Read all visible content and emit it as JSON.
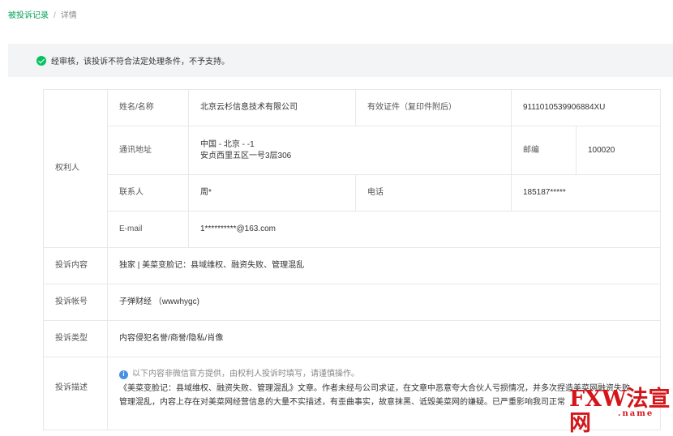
{
  "breadcrumb": {
    "parent": "被投诉记录",
    "separator": "/",
    "current": "详情"
  },
  "status": {
    "message": "经审核，该投诉不符合法定处理条件，不予支持。"
  },
  "rights_holder": {
    "section_label": "权利人",
    "name_label": "姓名/名称",
    "name_value": "北京云杉信息技术有限公司",
    "id_label": "有效证件（复印件附后）",
    "id_value": "9111010539906884XU",
    "address_label": "通讯地址",
    "address_line1": "中国 - 北京 - -1",
    "address_line2": "安贞西里五区一号3层306",
    "postcode_label": "邮编",
    "postcode_value": "100020",
    "contact_label": "联系人",
    "contact_value": "周*",
    "phone_label": "电话",
    "phone_value": "185187*****",
    "email_label": "E-mail",
    "email_value": "1**********@163.com"
  },
  "complaint": {
    "content_label": "投诉内容",
    "content_value": "独家 | 美菜变脸记：县域维权、融资失败、管理混乱",
    "account_label": "投诉帐号",
    "account_value": "子弹财经 （wwwhygc)",
    "type_label": "投诉类型",
    "type_value": "内容侵犯名誉/商誉/隐私/肖像",
    "desc_label": "投诉描述",
    "desc_notice": "以下内容非微信官方提供，由权利人投诉时填写，请谨慎操作。",
    "desc_line1": "《美菜变脸记：县域维权、融资失败、管理混乱》文章。作者未经与公司求证，在文章中恶意夸大合伙人亏损情况，并多次捏造美菜网融资失败、",
    "desc_line2": "管理混乱，内容上存在对美菜网经营信息的大量不实描述，有歪曲事实，故意抹黑、诋毁美菜网的嫌疑。已严重影响我司正常"
  },
  "watermark": {
    "text": "FXW法宣网",
    "sub": ".name"
  },
  "colors": {
    "accent": "#07a35a",
    "success": "#07c160",
    "info": "#4a90e2",
    "watermark": "#d4151a"
  },
  "icons": {
    "status": "check-circle-icon",
    "notice": "info-circle-icon"
  }
}
